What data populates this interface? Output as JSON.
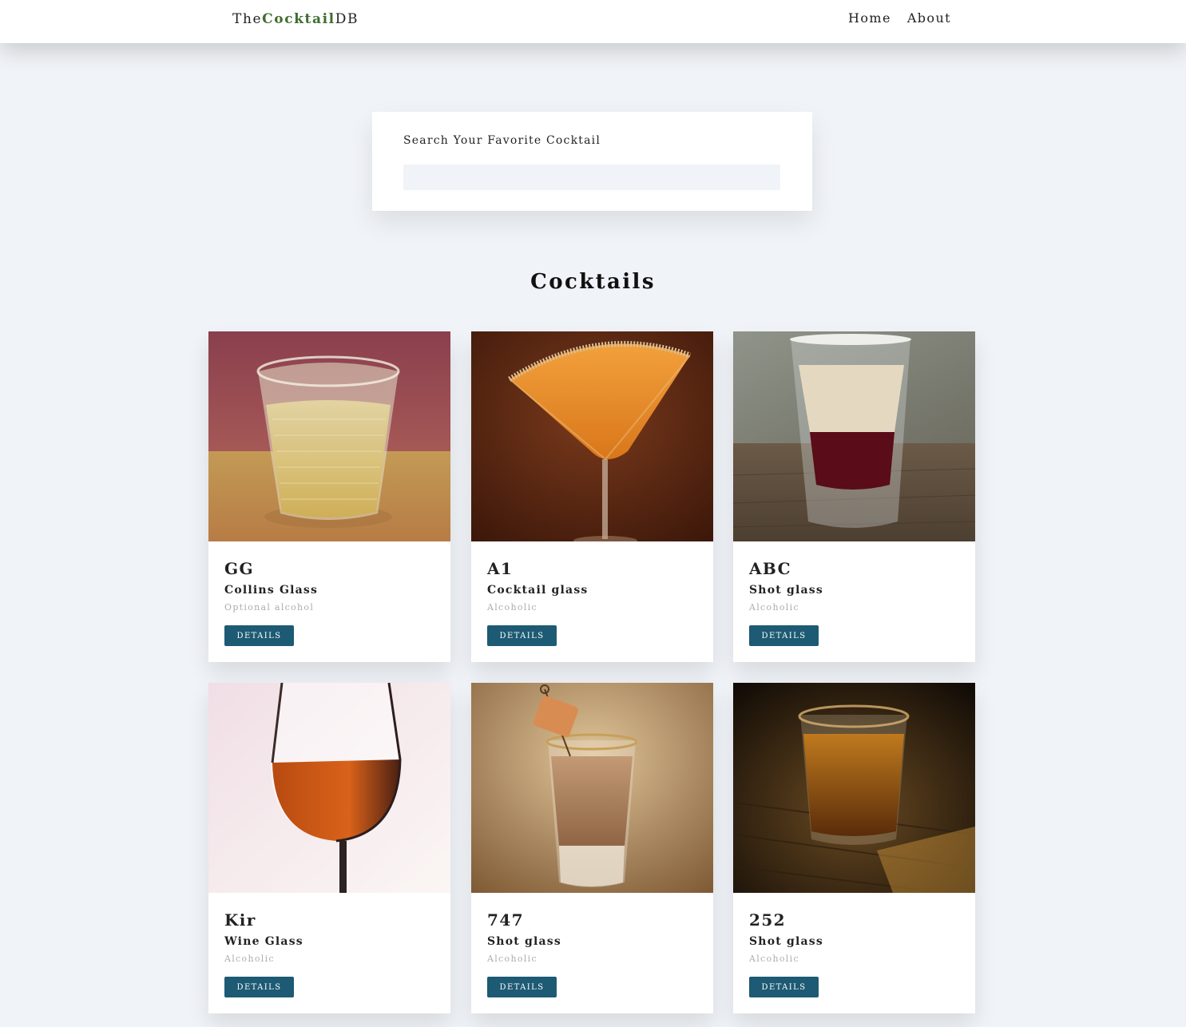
{
  "navbar": {
    "logo_prefix": "The",
    "logo_accent": "Cocktail",
    "logo_suffix": "DB",
    "links": [
      "Home",
      "About"
    ]
  },
  "search": {
    "label": "Search Your Favorite Cocktail",
    "value": ""
  },
  "section_title": "Cocktails",
  "colors": {
    "background": "#f0f3f7",
    "logo_accent": "#3f6d30",
    "button": "#1d5a73",
    "info_text": "#a8adb3"
  },
  "cocktails": [
    {
      "name": "GG",
      "glass": "Collins Glass",
      "info": "Optional alcohol",
      "button": "DETAILS"
    },
    {
      "name": "A1",
      "glass": "Cocktail glass",
      "info": "Alcoholic",
      "button": "DETAILS"
    },
    {
      "name": "ABC",
      "glass": "Shot glass",
      "info": "Alcoholic",
      "button": "DETAILS"
    },
    {
      "name": "Kir",
      "glass": "Wine Glass",
      "info": "Alcoholic",
      "button": "DETAILS"
    },
    {
      "name": "747",
      "glass": "Shot glass",
      "info": "Alcoholic",
      "button": "DETAILS"
    },
    {
      "name": "252",
      "glass": "Shot glass",
      "info": "Alcoholic",
      "button": "DETAILS"
    }
  ]
}
